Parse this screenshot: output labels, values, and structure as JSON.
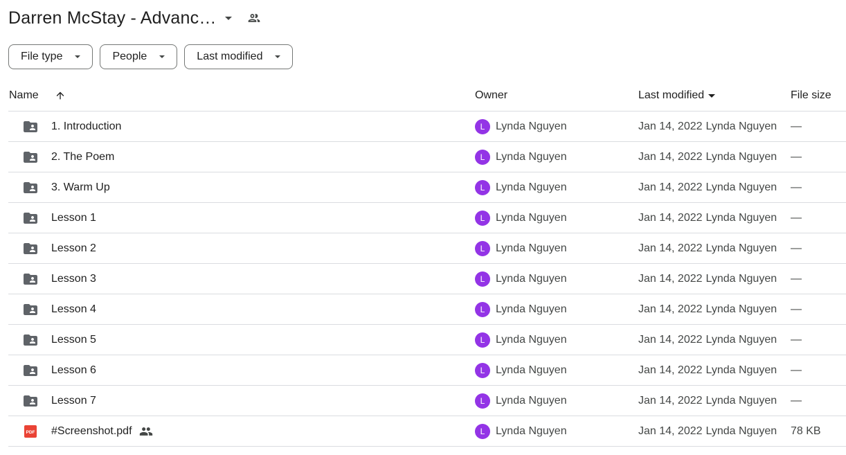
{
  "header": {
    "title": "Darren McStay - Advanc…"
  },
  "filters": [
    {
      "label": "File type"
    },
    {
      "label": "People"
    },
    {
      "label": "Last modified"
    }
  ],
  "columns": {
    "name": "Name",
    "owner": "Owner",
    "last_modified": "Last modified",
    "file_size": "File size"
  },
  "rows": [
    {
      "name": "1. Introduction",
      "type": "shared-folder",
      "owner_initial": "L",
      "owner": "Lynda Nguyen",
      "modified_date": "Jan 14, 2022",
      "modified_by": "Lynda Nguyen",
      "size": "—"
    },
    {
      "name": "2. The Poem",
      "type": "shared-folder",
      "owner_initial": "L",
      "owner": "Lynda Nguyen",
      "modified_date": "Jan 14, 2022",
      "modified_by": "Lynda Nguyen",
      "size": "—"
    },
    {
      "name": "3. Warm Up",
      "type": "shared-folder",
      "owner_initial": "L",
      "owner": "Lynda Nguyen",
      "modified_date": "Jan 14, 2022",
      "modified_by": "Lynda Nguyen",
      "size": "—"
    },
    {
      "name": "Lesson 1",
      "type": "shared-folder",
      "owner_initial": "L",
      "owner": "Lynda Nguyen",
      "modified_date": "Jan 14, 2022",
      "modified_by": "Lynda Nguyen",
      "size": "—"
    },
    {
      "name": "Lesson 2",
      "type": "shared-folder",
      "owner_initial": "L",
      "owner": "Lynda Nguyen",
      "modified_date": "Jan 14, 2022",
      "modified_by": "Lynda Nguyen",
      "size": "—"
    },
    {
      "name": "Lesson 3",
      "type": "shared-folder",
      "owner_initial": "L",
      "owner": "Lynda Nguyen",
      "modified_date": "Jan 14, 2022",
      "modified_by": "Lynda Nguyen",
      "size": "—"
    },
    {
      "name": "Lesson 4",
      "type": "shared-folder",
      "owner_initial": "L",
      "owner": "Lynda Nguyen",
      "modified_date": "Jan 14, 2022",
      "modified_by": "Lynda Nguyen",
      "size": "—"
    },
    {
      "name": "Lesson 5",
      "type": "shared-folder",
      "owner_initial": "L",
      "owner": "Lynda Nguyen",
      "modified_date": "Jan 14, 2022",
      "modified_by": "Lynda Nguyen",
      "size": "—"
    },
    {
      "name": "Lesson 6",
      "type": "shared-folder",
      "owner_initial": "L",
      "owner": "Lynda Nguyen",
      "modified_date": "Jan 14, 2022",
      "modified_by": "Lynda Nguyen",
      "size": "—"
    },
    {
      "name": "Lesson 7",
      "type": "shared-folder",
      "owner_initial": "L",
      "owner": "Lynda Nguyen",
      "modified_date": "Jan 14, 2022",
      "modified_by": "Lynda Nguyen",
      "size": "—"
    },
    {
      "name": "#Screenshot.pdf",
      "type": "pdf",
      "pdf_label": "PDF",
      "shared": true,
      "owner_initial": "L",
      "owner": "Lynda Nguyen",
      "modified_date": "Jan 14, 2022",
      "modified_by": "Lynda Nguyen",
      "size": "78 KB"
    }
  ],
  "colors": {
    "avatar": "#9334e6",
    "folder": "#5f6368",
    "pdf": "#ea4335",
    "divider": "#dadce0"
  }
}
